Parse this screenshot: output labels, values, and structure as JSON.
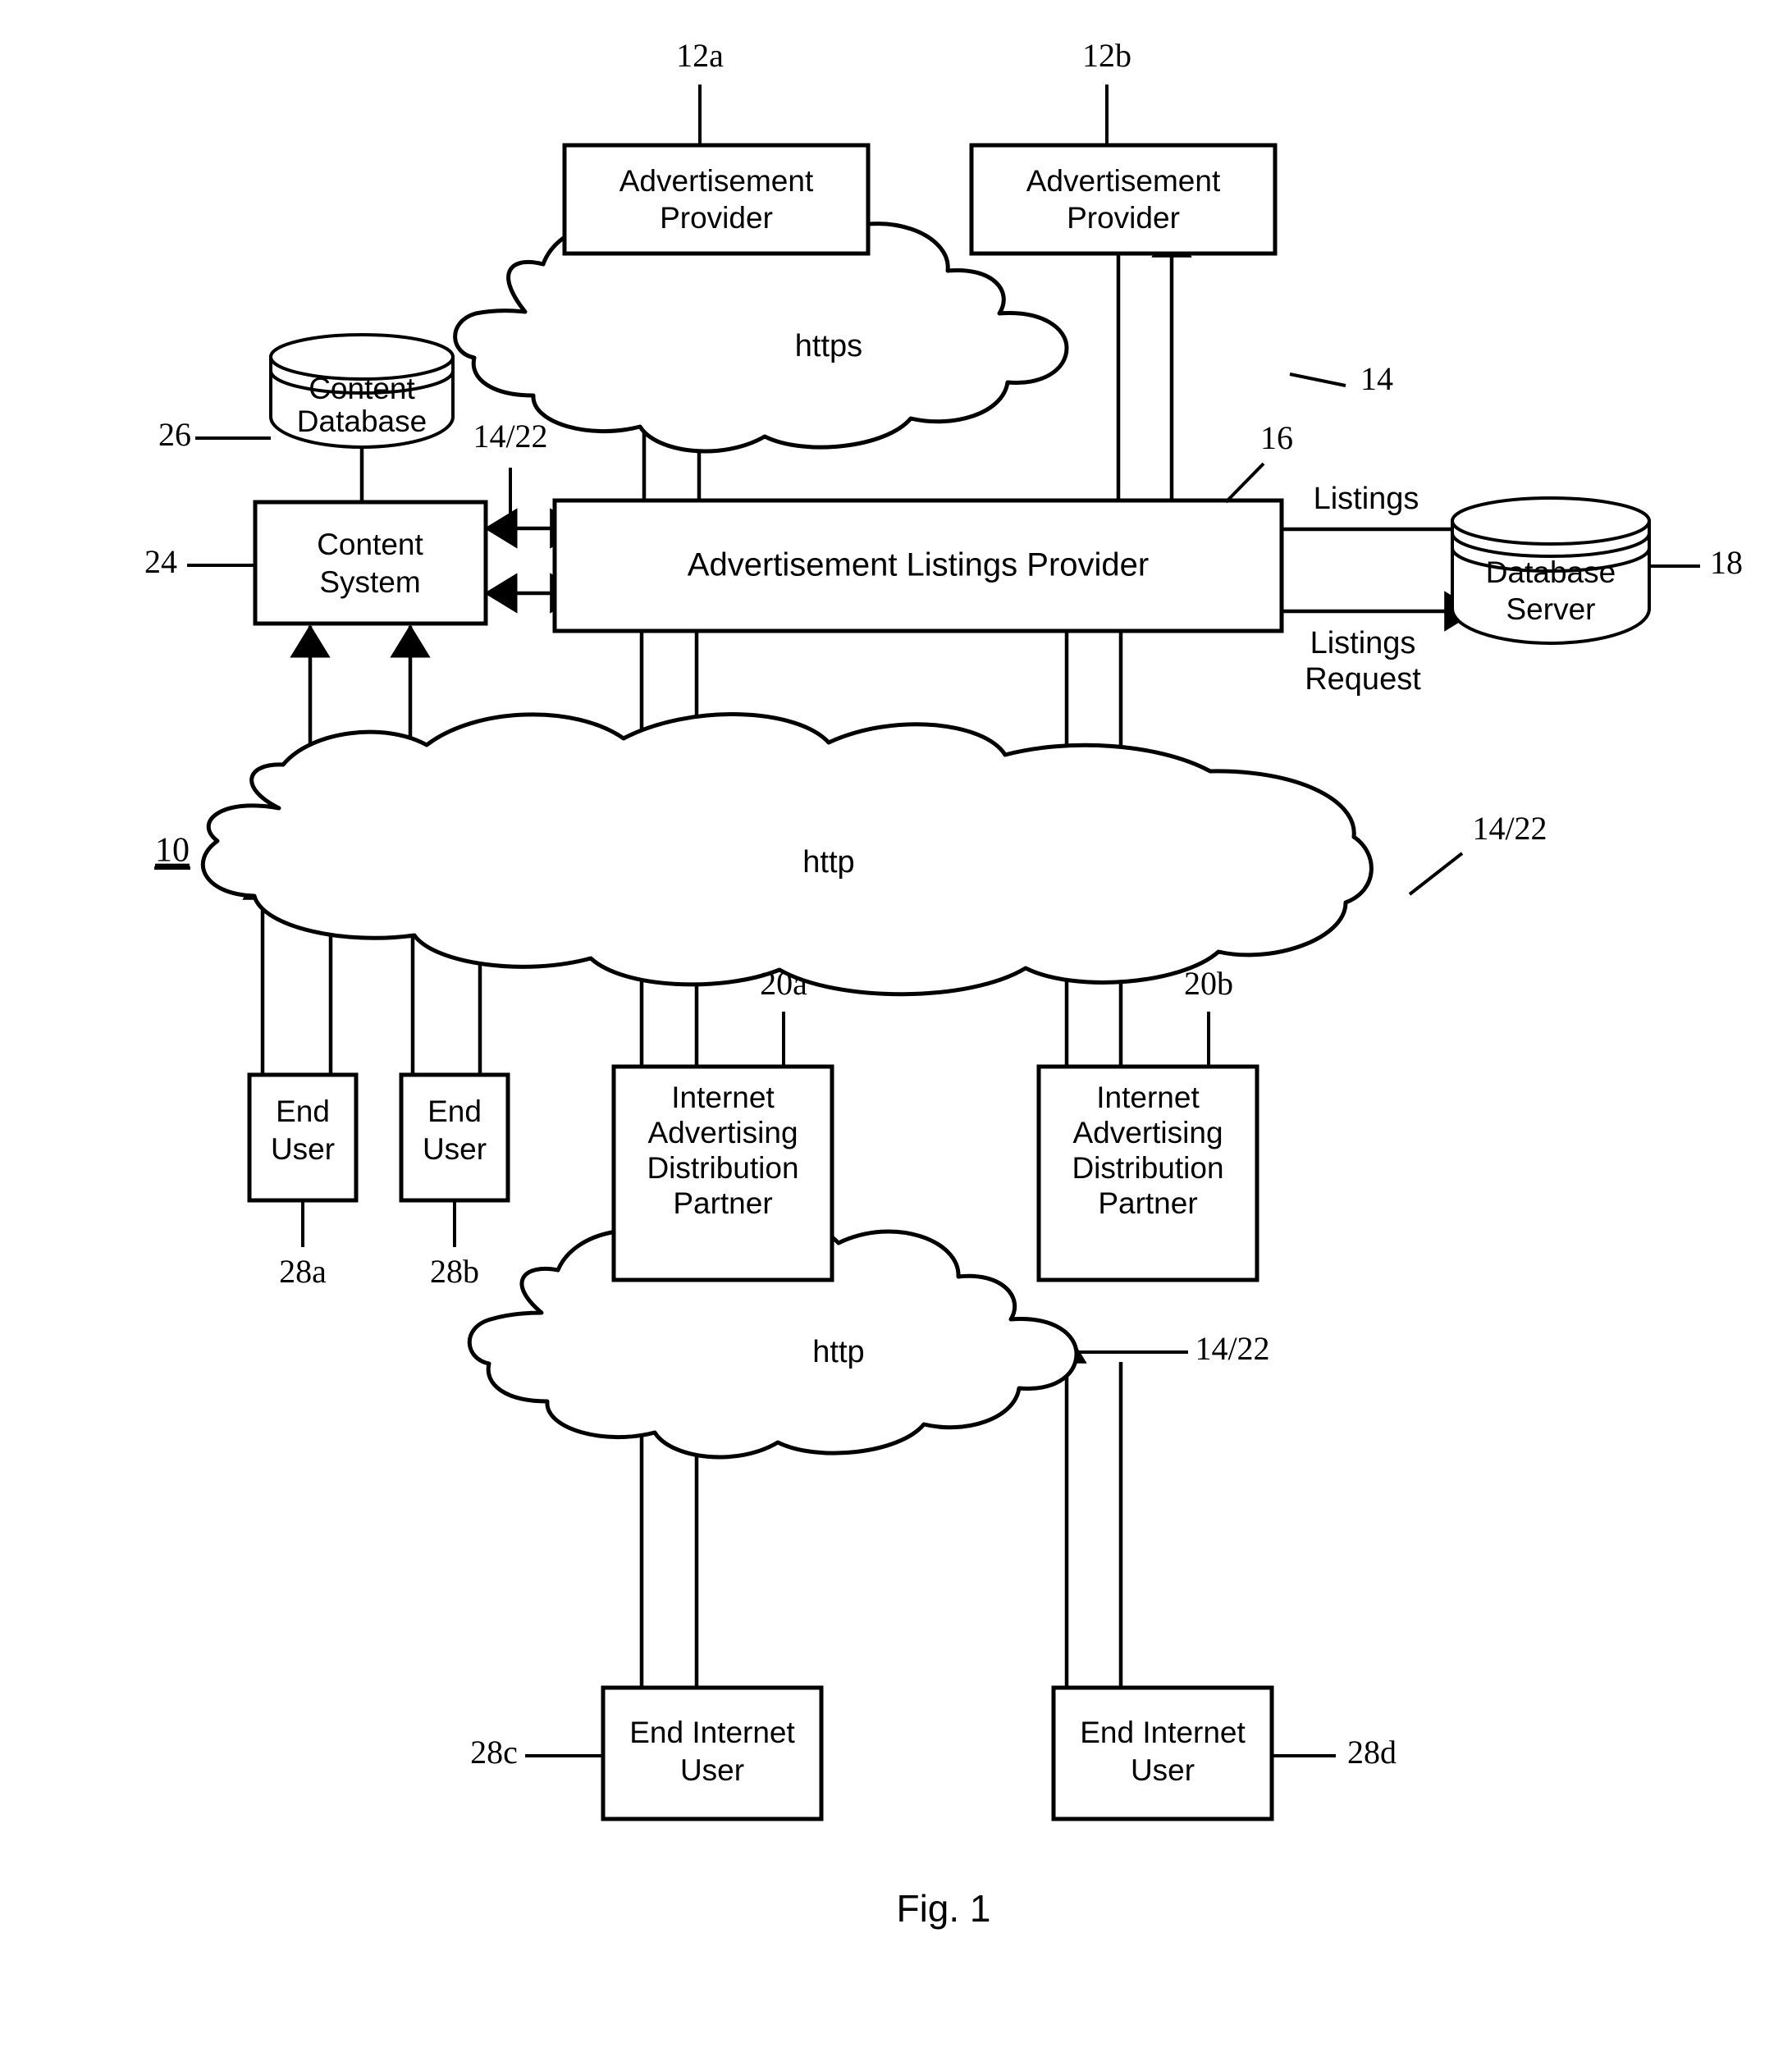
{
  "figure": {
    "caption": "Fig. 1",
    "system_ref": "10"
  },
  "nodes": {
    "ad_provider_a": {
      "line1": "Advertisement",
      "line2": "Provider",
      "ref": "12a"
    },
    "ad_provider_b": {
      "line1": "Advertisement",
      "line2": "Provider",
      "ref": "12b"
    },
    "content_database": {
      "line1": "Content",
      "line2": "Database",
      "ref": "26"
    },
    "content_system": {
      "line1": "Content",
      "line2": "System",
      "ref": "24"
    },
    "ad_listings_provider": {
      "label": "Advertisement Listings Provider",
      "ref": "16"
    },
    "database_server": {
      "line1": "Database",
      "line2": "Server",
      "ref": "18"
    },
    "end_user_a": {
      "line1": "End",
      "line2": "User",
      "ref": "28a"
    },
    "end_user_b": {
      "line1": "End",
      "line2": "User",
      "ref": "28b"
    },
    "iadp_a": {
      "line1": "Internet",
      "line2": "Advertising",
      "line3": "Distribution",
      "line4": "Partner",
      "ref": "20a"
    },
    "iadp_b": {
      "line1": "Internet",
      "line2": "Advertising",
      "line3": "Distribution",
      "line4": "Partner",
      "ref": "20b"
    },
    "end_internet_user_c": {
      "line1": "End Internet",
      "line2": "User",
      "ref": "28c"
    },
    "end_internet_user_d": {
      "line1": "End Internet",
      "line2": "User",
      "ref": "28d"
    }
  },
  "networks": {
    "https_cloud": {
      "label": "https",
      "ref": "14"
    },
    "http_cloud_middle": {
      "label": "http",
      "ref": "14/22"
    },
    "http_cloud_bottom": {
      "label": "http",
      "ref": "14/22"
    },
    "content_link": {
      "ref": "14/22"
    }
  },
  "edges": {
    "listings": "Listings",
    "listings_request_line1": "Listings",
    "listings_request_line2": "Request"
  },
  "colors": {
    "ink": "#000000",
    "paper": "#ffffff"
  }
}
